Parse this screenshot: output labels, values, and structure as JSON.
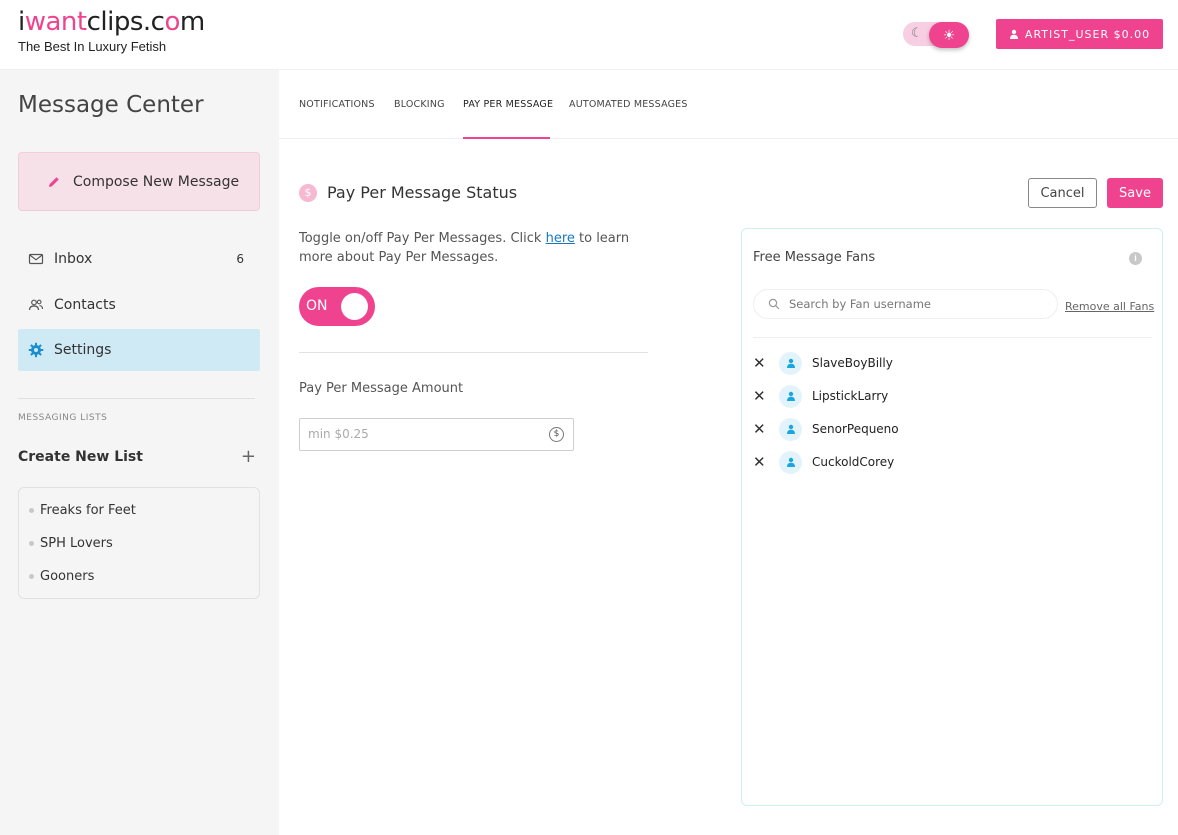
{
  "header": {
    "logo_prefix": "i",
    "logo_want": "want",
    "logo_clips": "clips.c",
    "logo_o": "o",
    "logo_m": "m",
    "tagline": "The Best In Luxury Fetish",
    "user_button": "ARTIST_USER $0.00",
    "theme_moon_icon": "moon-icon",
    "theme_sun_icon": "sun-icon"
  },
  "sidebar": {
    "title": "Message Center",
    "compose_label": "Compose New Message",
    "nav": [
      {
        "label": "Inbox",
        "count": "6",
        "icon": "mail-icon"
      },
      {
        "label": "Contacts",
        "icon": "contacts-icon"
      },
      {
        "label": "Settings",
        "icon": "gear-icon"
      }
    ],
    "section_label": "MESSAGING LISTS",
    "create_list_label": "Create New List",
    "lists": [
      "Freaks for Feet",
      "SPH Lovers",
      "Gooners"
    ]
  },
  "tabs": [
    "NOTIFICATIONS",
    "BLOCKING",
    "PAY PER MESSAGE",
    "AUTOMATED MESSAGES"
  ],
  "active_tab": "PAY PER MESSAGE",
  "status": {
    "title": "Pay Per Message Status",
    "cancel_label": "Cancel",
    "save_label": "Save",
    "desc_before": "Toggle on/off Pay Per Messages. Click ",
    "desc_link": "here",
    "desc_after": " to learn more about Pay Per Messages.",
    "toggle_label": "ON",
    "toggle_on": true,
    "amount_label": "Pay Per Message Amount",
    "amount_placeholder": "min $0.25",
    "amount_value": ""
  },
  "fans": {
    "title": "Free Message Fans",
    "search_placeholder": "Search by Fan username",
    "remove_all_label": "Remove all Fans",
    "list": [
      "SlaveBoyBilly",
      "LipstickLarry",
      "SenorPequeno",
      "CuckoldCorey"
    ]
  },
  "colors": {
    "accent": "#f0438f",
    "active_nav": "#cfe9f5",
    "compose_bg": "#f7e1e9"
  }
}
